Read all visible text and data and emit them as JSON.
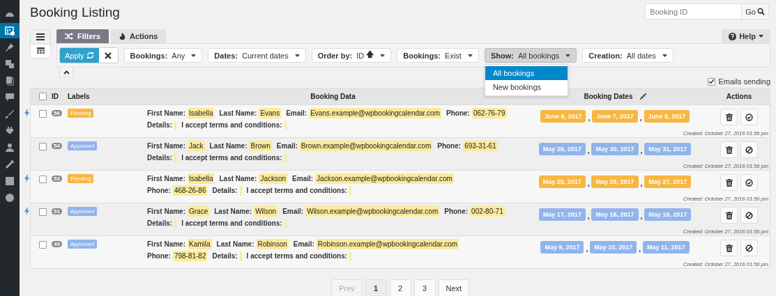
{
  "sidebar": [
    {
      "selected": false
    },
    {
      "selected": true
    },
    {
      "selected": false
    },
    {
      "selected": false
    },
    {
      "selected": false
    },
    {
      "selected": false
    },
    {
      "selected": false
    },
    {
      "selected": false
    },
    {
      "selected": false
    },
    {
      "selected": false
    },
    {
      "selected": false
    },
    {
      "selected": false
    }
  ],
  "page_title": "Booking Listing",
  "search": {
    "placeholder": "Booking ID",
    "button": "Go"
  },
  "views": [
    {
      "kind": "list",
      "selected": true
    },
    {
      "kind": "calendar",
      "selected": false
    }
  ],
  "tabs": [
    {
      "label": "Filters",
      "kind": "filters",
      "selected": true
    },
    {
      "label": "Actions",
      "kind": "actions",
      "selected": false
    }
  ],
  "help": {
    "label": "Help"
  },
  "apply": {
    "label": "Apply"
  },
  "filters": [
    {
      "label": "Bookings:",
      "value": "Any",
      "open": false
    },
    {
      "label": "Dates:",
      "value": "Current dates",
      "open": false
    },
    {
      "label": "Order by:",
      "value": "ID",
      "sort": "🡅",
      "open": false
    },
    {
      "label": "Bookings:",
      "value": "Exist",
      "open": false
    },
    {
      "label": "Show:",
      "value": "All bookings",
      "open": true,
      "options": [
        {
          "label": "All bookings",
          "selected": true
        },
        {
          "label": "New bookings",
          "selected": false
        }
      ]
    },
    {
      "label": "Creation:",
      "value": "All dates",
      "open": false
    }
  ],
  "emails_sending": {
    "label": "Emails sending",
    "checked": true
  },
  "select_all": {
    "checked": false
  },
  "columns": [
    "ID",
    "Labels",
    "Booking Data",
    "Booking Dates",
    "Actions"
  ],
  "date_separator": ",",
  "rows": [
    {
      "id": "56",
      "checked": false,
      "new": true,
      "approved": false,
      "status": "Pending",
      "fields": [
        {
          "label": "First Name:",
          "value": "Isabella"
        },
        {
          "label": "Last Name:",
          "value": "Evans"
        },
        {
          "label": "Email:",
          "value": "Evans.example@wpbookingcalendar.com"
        },
        {
          "label": "Phone:",
          "value": "062-76-79"
        },
        {
          "label": "Details:"
        },
        {
          "label": "I accept terms and conditions:"
        }
      ],
      "dates": [
        "June 6, 2017",
        "June 7, 2017",
        "June 8, 2017"
      ],
      "created": "Created: October 27, 2016 01:56 pm"
    },
    {
      "id": "54",
      "checked": false,
      "new": false,
      "approved": true,
      "status": "Approved",
      "fields": [
        {
          "label": "First Name:",
          "value": "Jack"
        },
        {
          "label": "Last Name:",
          "value": "Brown"
        },
        {
          "label": "Email:",
          "value": "Brown.example@wpbookingcalendar.com"
        },
        {
          "label": "Phone:",
          "value": "693-31-61"
        },
        {
          "label": "Details:"
        },
        {
          "label": "I accept terms and conditions:"
        }
      ],
      "dates": [
        "May 29, 2017",
        "May 30, 2017",
        "May 31, 2017"
      ],
      "created": "Created: October 27, 2016 01:56 pm"
    },
    {
      "id": "53",
      "checked": false,
      "new": true,
      "approved": false,
      "status": "Pending",
      "fields": [
        {
          "label": "First Name:",
          "value": "Isabella"
        },
        {
          "label": "Last Name:",
          "value": "Jackson"
        },
        {
          "label": "Email:",
          "value": "Jackson.example@wpbookingcalendar.com"
        },
        {
          "label": "Phone:",
          "value": "468-26-86"
        },
        {
          "label": "Details:"
        },
        {
          "label": "I accept terms and conditions:"
        }
      ],
      "dates": [
        "May 25, 2017",
        "May 26, 2017",
        "May 27, 2017"
      ],
      "created": "Created: October 27, 2016 01:56 pm"
    },
    {
      "id": "51",
      "checked": false,
      "new": true,
      "approved": true,
      "status": "Approved",
      "fields": [
        {
          "label": "First Name:",
          "value": "Grace"
        },
        {
          "label": "Last Name:",
          "value": "Wilson"
        },
        {
          "label": "Email:",
          "value": "Wilson.example@wpbookingcalendar.com"
        },
        {
          "label": "Phone:",
          "value": "002-80-71"
        },
        {
          "label": "Details:"
        },
        {
          "label": "I accept terms and conditions:"
        }
      ],
      "dates": [
        "May 17, 2017",
        "May 18, 2017",
        "May 19, 2017"
      ],
      "created": "Created: October 27, 2016 01:56 pm"
    },
    {
      "id": "49",
      "checked": false,
      "new": false,
      "approved": true,
      "status": "Approved",
      "fields": [
        {
          "label": "First Name:",
          "value": "Kamila"
        },
        {
          "label": "Last Name:",
          "value": "Robinson"
        },
        {
          "label": "Email:",
          "value": "Robinson.example@wpbookingcalendar.com"
        },
        {
          "label": "Phone:",
          "value": "798-81-82"
        },
        {
          "label": "Details:"
        },
        {
          "label": "I accept terms and conditions:"
        }
      ],
      "dates": [
        "May 9, 2017",
        "May 10, 2017",
        "May 11, 2017"
      ],
      "created": "Created: October 27, 2016 01:56 pm"
    }
  ],
  "pagination": [
    {
      "label": "Prev",
      "disabled": true,
      "selected": false
    },
    {
      "label": "1",
      "disabled": false,
      "selected": true
    },
    {
      "label": "2",
      "disabled": false,
      "selected": false
    },
    {
      "label": "3",
      "disabled": false,
      "selected": false
    },
    {
      "label": "Next",
      "disabled": false,
      "selected": false
    }
  ]
}
